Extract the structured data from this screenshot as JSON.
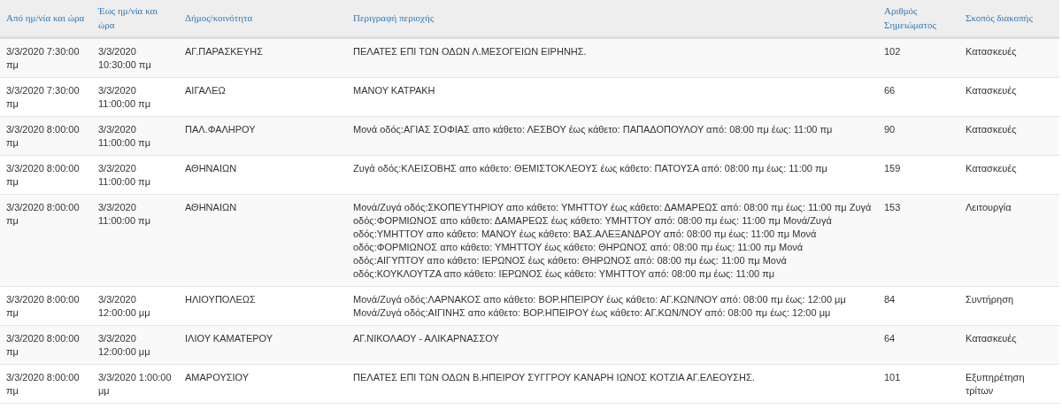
{
  "table": {
    "columns": [
      "Από ημ/νία και ώρα",
      "Έως ημ/νία και ώρα",
      "Δήμος/κοινότητα",
      "Περιγραφή περιοχής",
      "Αριθμός Σημειώματος",
      "Σκοπός διακοπής"
    ],
    "rows": [
      [
        "3/3/2020 7:30:00 πμ",
        "3/3/2020 10:30:00 πμ",
        "ΑΓ.ΠΑΡΑΣΚΕΥΗΣ",
        "ΠΕΛΑΤΕΣ ΕΠΙ ΤΩΝ ΟΔΩΝ Λ.ΜΕΣΟΓΕΙΩΝ ΕΙΡΗΝΗΣ.",
        "102",
        "Κατασκευές"
      ],
      [
        "3/3/2020 7:30:00 πμ",
        "3/3/2020 11:00:00 πμ",
        "ΑΙΓΑΛΕΩ",
        "ΜΑΝΟΥ ΚΑΤΡΑΚΗ",
        "66",
        "Κατασκευές"
      ],
      [
        "3/3/2020 8:00:00 πμ",
        "3/3/2020 11:00:00 πμ",
        "ΠΑΛ.ΦΑΛΗΡΟΥ",
        "Μονά οδός:ΑΓΙΑΣ ΣΟΦΙΑΣ απο κάθετο: ΛΕΣΒΟΥ έως κάθετο: ΠΑΠΑΔΟΠΟΥΛΟΥ από: 08:00 πμ έως: 11:00 πμ",
        "90",
        "Κατασκευές"
      ],
      [
        "3/3/2020 8:00:00 πμ",
        "3/3/2020 11:00:00 πμ",
        "ΑΘΗΝΑΙΩΝ",
        "Ζυγά οδός:ΚΛΕΙΣΟΒΗΣ απο κάθετο: ΘΕΜΙΣΤΟΚΛΕΟΥΣ έως κάθετο: ΠΑΤΟΥΣΑ από: 08:00 πμ έως: 11:00 πμ",
        "159",
        "Κατασκευές"
      ],
      [
        "3/3/2020 8:00:00 πμ",
        "3/3/2020 11:00:00 πμ",
        "ΑΘΗΝΑΙΩΝ",
        "Μονά/Ζυγά οδός:ΣΚΟΠΕΥΤΗΡΙΟΥ απο κάθετο: ΥΜΗΤΤΟΥ έως κάθετο: ΔΑΜΑΡΕΩΣ από: 08:00 πμ έως: 11:00 πμ Ζυγά οδός:ΦΟΡΜΙΩΝΟΣ απο κάθετο: ΔΑΜΑΡΕΩΣ έως κάθετο: ΥΜΗΤΤΟΥ από: 08:00 πμ έως: 11:00 πμ Μονά/Ζυγά οδός:ΥΜΗΤΤΟΥ απο κάθετο: ΜΑΝΟΥ έως κάθετο: ΒΑΣ.ΑΛΕΞΑΝΔΡΟΥ από: 08:00 πμ έως: 11:00 πμ Μονά οδός:ΦΟΡΜΙΩΝΟΣ απο κάθετο: ΥΜΗΤΤΟΥ έως κάθετο: ΘΗΡΩΝΟΣ από: 08:00 πμ έως: 11:00 πμ Μονά οδός:ΑΙΓΥΠΤΟΥ απο κάθετο: ΙΕΡΩΝΟΣ έως κάθετο: ΘΗΡΩΝΟΣ από: 08:00 πμ έως: 11:00 πμ Μονά οδός:ΚΟΥΚΛΟΥΤΖΑ απο κάθετο: ΙΕΡΩΝΟΣ έως κάθετο: ΥΜΗΤΤΟΥ από: 08:00 πμ έως: 11:00 πμ",
        "153",
        "Λειτουργία"
      ],
      [
        "3/3/2020 8:00:00 πμ",
        "3/3/2020 12:00:00 μμ",
        "ΗΛΙΟΥΠΟΛΕΩΣ",
        "Μονά/Ζυγά οδός:ΛΑΡΝΑΚΟΣ απο κάθετο: ΒΟΡ.ΗΠΕΙΡΟΥ έως κάθετο: ΑΓ.ΚΩΝ/ΝΟΥ από: 08:00 πμ έως: 12:00 μμ Μονά/Ζυγά οδός:ΑΙΓΙΝΗΣ απο κάθετο: ΒΟΡ.ΗΠΕΙΡΟΥ έως κάθετο: ΑΓ.ΚΩΝ/ΝΟΥ από: 08:00 πμ έως: 12:00 μμ",
        "84",
        "Συντήρηση"
      ],
      [
        "3/3/2020 8:00:00 πμ",
        "3/3/2020 12:00:00 μμ",
        "ΙΛΙΟΥ ΚΑΜΑΤΕΡΟΥ",
        "ΑΓ.ΝΙΚΟΛΑΟΥ - ΑΛΙΚΑΡΝΑΣΣΟΥ",
        "64",
        "Κατασκευές"
      ],
      [
        "3/3/2020 8:00:00 πμ",
        "3/3/2020 1:00:00 μμ",
        "ΑΜΑΡΟΥΣΙΟΥ",
        "ΠΕΛΑΤΕΣ ΕΠΙ ΤΩΝ ΟΔΩΝ Β.ΗΠΕΙΡΟΥ ΣΥΓΓΡΟΥ ΚΑΝΑΡΗ ΙΩΝΟΣ ΚΟΤΖΙΑ ΑΓ.ΕΛΕΟΥΣΗΣ.",
        "101",
        "Εξυπηρέτηση τρίτων"
      ]
    ]
  }
}
